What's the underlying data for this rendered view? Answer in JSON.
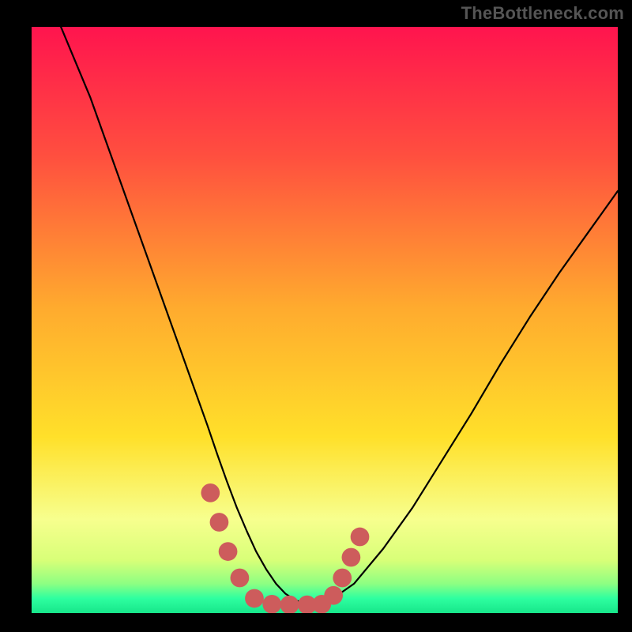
{
  "watermark": "TheBottleneck.com",
  "chart_data": {
    "type": "line",
    "title": "",
    "xlabel": "",
    "ylabel": "",
    "xlim": [
      0,
      100
    ],
    "ylim": [
      0,
      100
    ],
    "grid": false,
    "legend": false,
    "background_gradient": {
      "top_color": "#ff144e",
      "mid_color": "#ffe02a",
      "bottom_colors": [
        "#f7ff8e",
        "#b3ff7a",
        "#2effa0",
        "#17e68a"
      ]
    },
    "series": [
      {
        "name": "bottleneck-curve",
        "stroke": "#000000",
        "x": [
          5,
          7.5,
          10,
          12.5,
          15,
          17.5,
          20,
          22.5,
          25,
          27.5,
          30,
          31.7,
          33.3,
          35,
          36.7,
          38.3,
          40,
          41.7,
          43.3,
          45,
          46.7,
          48.3,
          50,
          55,
          60,
          65,
          70,
          75,
          80,
          85,
          90,
          95,
          100
        ],
        "y": [
          100,
          94,
          88,
          81,
          74,
          67,
          60,
          53,
          46,
          39,
          32,
          27,
          22.5,
          18,
          14,
          10.5,
          7.5,
          5,
          3.3,
          2.2,
          1.6,
          1.3,
          1.5,
          5,
          11,
          18,
          26,
          34,
          42.5,
          50.5,
          58,
          65,
          72
        ],
        "markers": [
          {
            "x": 30.5,
            "y": 20.5
          },
          {
            "x": 32.0,
            "y": 15.5
          },
          {
            "x": 33.5,
            "y": 10.5
          },
          {
            "x": 35.5,
            "y": 6.0
          },
          {
            "x": 38.0,
            "y": 2.5
          },
          {
            "x": 41.0,
            "y": 1.5
          },
          {
            "x": 44.0,
            "y": 1.4
          },
          {
            "x": 47.0,
            "y": 1.4
          },
          {
            "x": 49.5,
            "y": 1.5
          },
          {
            "x": 51.5,
            "y": 3.0
          },
          {
            "x": 53.0,
            "y": 6.0
          },
          {
            "x": 54.5,
            "y": 9.5
          },
          {
            "x": 56.0,
            "y": 13.0
          }
        ],
        "marker_color": "#cd5c5c",
        "marker_radius_pct": 1.6
      }
    ]
  }
}
